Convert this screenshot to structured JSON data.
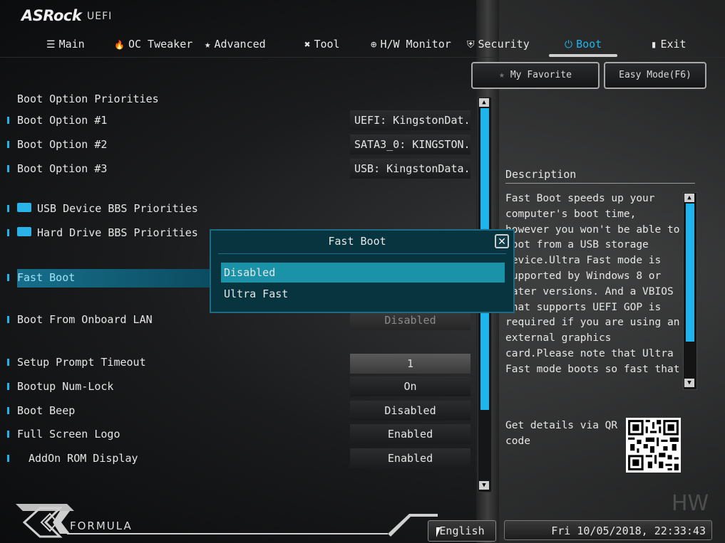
{
  "brand": {
    "logo": "ASRock",
    "sub": "UEFI"
  },
  "tabs": [
    {
      "label": "Main",
      "icon": "☰"
    },
    {
      "label": "OC Tweaker",
      "icon": "🔥"
    },
    {
      "label": "Advanced",
      "icon": "★"
    },
    {
      "label": "Tool",
      "icon": "✖"
    },
    {
      "label": "H/W Monitor",
      "icon": "⊕"
    },
    {
      "label": "Security",
      "icon": "⛨"
    },
    {
      "label": "Boot",
      "icon": "⏻"
    },
    {
      "label": "Exit",
      "icon": "▮"
    }
  ],
  "active_tab": "Boot",
  "top_buttons": {
    "favorite": "My Favorite",
    "easy_mode": "Easy Mode(F6)"
  },
  "section_title": "Boot Option Priorities",
  "rows": {
    "boot1": {
      "label": "Boot Option #1",
      "value": "UEFI: KingstonDat..."
    },
    "boot2": {
      "label": "Boot Option #2",
      "value": "SATA3_0: KINGSTON..."
    },
    "boot3": {
      "label": "Boot Option #3",
      "value": "USB: KingstonData..."
    },
    "usb_bbs": {
      "label": "USB Device BBS Priorities"
    },
    "hdd_bbs": {
      "label": "Hard Drive BBS Priorities"
    },
    "fast_boot": {
      "label": "Fast Boot"
    },
    "onboard_lan": {
      "label": "Boot From Onboard LAN",
      "value": "Disabled"
    },
    "setup_timeout": {
      "label": "Setup Prompt Timeout",
      "value": "1"
    },
    "numlock": {
      "label": "Bootup Num-Lock",
      "value": "On"
    },
    "beep": {
      "label": "Boot Beep",
      "value": "Disabled"
    },
    "fullscreen_logo": {
      "label": "Full Screen Logo",
      "value": "Enabled"
    },
    "addon_rom": {
      "label": "AddOn ROM Display",
      "value": "Enabled"
    }
  },
  "description": {
    "title": "Description",
    "text": "Fast Boot speeds up your computer's boot time, however you won't be able to boot from a USB storage device.Ultra Fast mode is supported by Windows 8 or later versions. And a VBIOS that supports UEFI GOP is required if you are using an external graphics card.Please note that Ultra Fast mode boots so fast that the only way to enter this",
    "qr_label": "Get details via QR code"
  },
  "modal": {
    "title": "Fast Boot",
    "options": [
      "Disabled",
      "Ultra Fast"
    ],
    "selected": "Disabled"
  },
  "footer": {
    "brand": "FORMULA",
    "language": "English",
    "datetime": "Fri 10/05/2018, 22:33:43",
    "watermark": "HW"
  }
}
